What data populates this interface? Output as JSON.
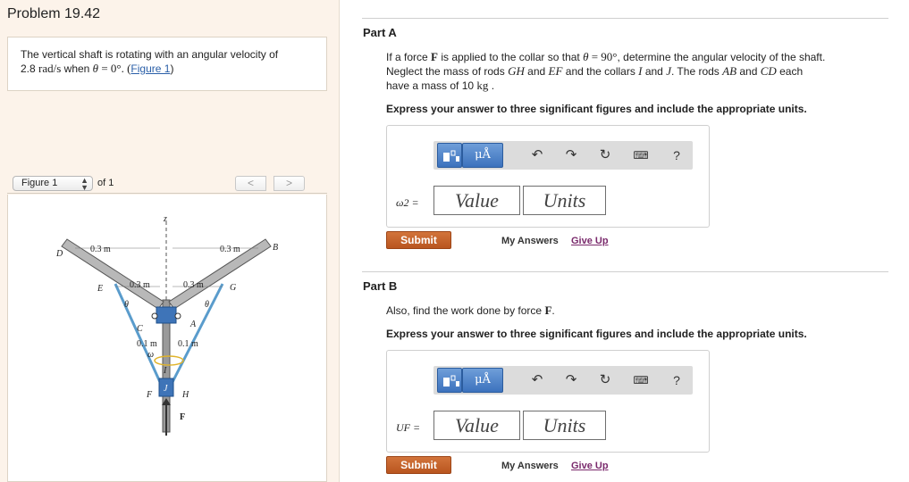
{
  "problem": {
    "title": "Problem 19.42"
  },
  "description": {
    "text1": "The vertical shaft is rotating with an angular velocity of",
    "value": "2.8",
    "unit": "rad/s",
    "when": " when ",
    "theta": "θ",
    "cond": " = 0°. (",
    "link": "Figure 1",
    "close": ")"
  },
  "figure_nav": {
    "select_label": "Figure 1",
    "of_label": "of 1",
    "prev": "<",
    "next": ">"
  },
  "figure": {
    "labels": {
      "z": "z",
      "D": "D",
      "B": "B",
      "E": "E",
      "G": "G",
      "C": "C",
      "A": "A",
      "F": "F",
      "H": "H",
      "Fforce": "F",
      "d1": "0.3 m",
      "d2": "0.3 m",
      "d3": "0.3 m",
      "d4": "0.3 m",
      "d5": "0.1 m",
      "d6": "0.1 m",
      "th1": "θ",
      "th2": "θ",
      "omega": "ω",
      "I": "I",
      "J": "J"
    }
  },
  "partA": {
    "title": "Part A",
    "q1": "If a force ",
    "F": "F",
    "q2": " is applied to the collar so that ",
    "theta": "θ",
    "q3": " = 90°",
    "q4": ", determine the angular velocity of the shaft.",
    "q5": "Neglect the mass of rods ",
    "GH": "GH",
    "and1": " and ",
    "EF": "EF",
    "q6": " and the collars ",
    "I": "I",
    "and2": " and ",
    "J": "J",
    "q7": ". The rods ",
    "AB": "AB",
    "and3": " and ",
    "CD": "CD",
    "q8": " each",
    "q9": "have a mass of ",
    "mass": "10",
    "kg": "kg",
    "q10": " .",
    "instruction": "Express your answer to three significant figures and include the appropriate units.",
    "var_label": "ω2 =",
    "value_placeholder": "Value",
    "units_placeholder": "Units",
    "submit": "Submit",
    "my_answers": "My Answers",
    "give_up": "Give Up"
  },
  "partB": {
    "title": "Part B",
    "q1": "Also, find the work done by force ",
    "F": "F",
    "q2": ".",
    "instruction": "Express your answer to three significant figures and include the appropriate units.",
    "var_label": "UF =",
    "value_placeholder": "Value",
    "units_placeholder": "Units",
    "submit": "Submit",
    "my_answers": "My Answers",
    "give_up": "Give Up"
  },
  "toolbar": {
    "mu_label": "μÅ",
    "help": "?"
  },
  "colors": {
    "submit": "#c2622a",
    "toolbar_btn": "#4a82c8",
    "give_up": "#7a2a6c",
    "left_bg": "#fcf3ea"
  }
}
